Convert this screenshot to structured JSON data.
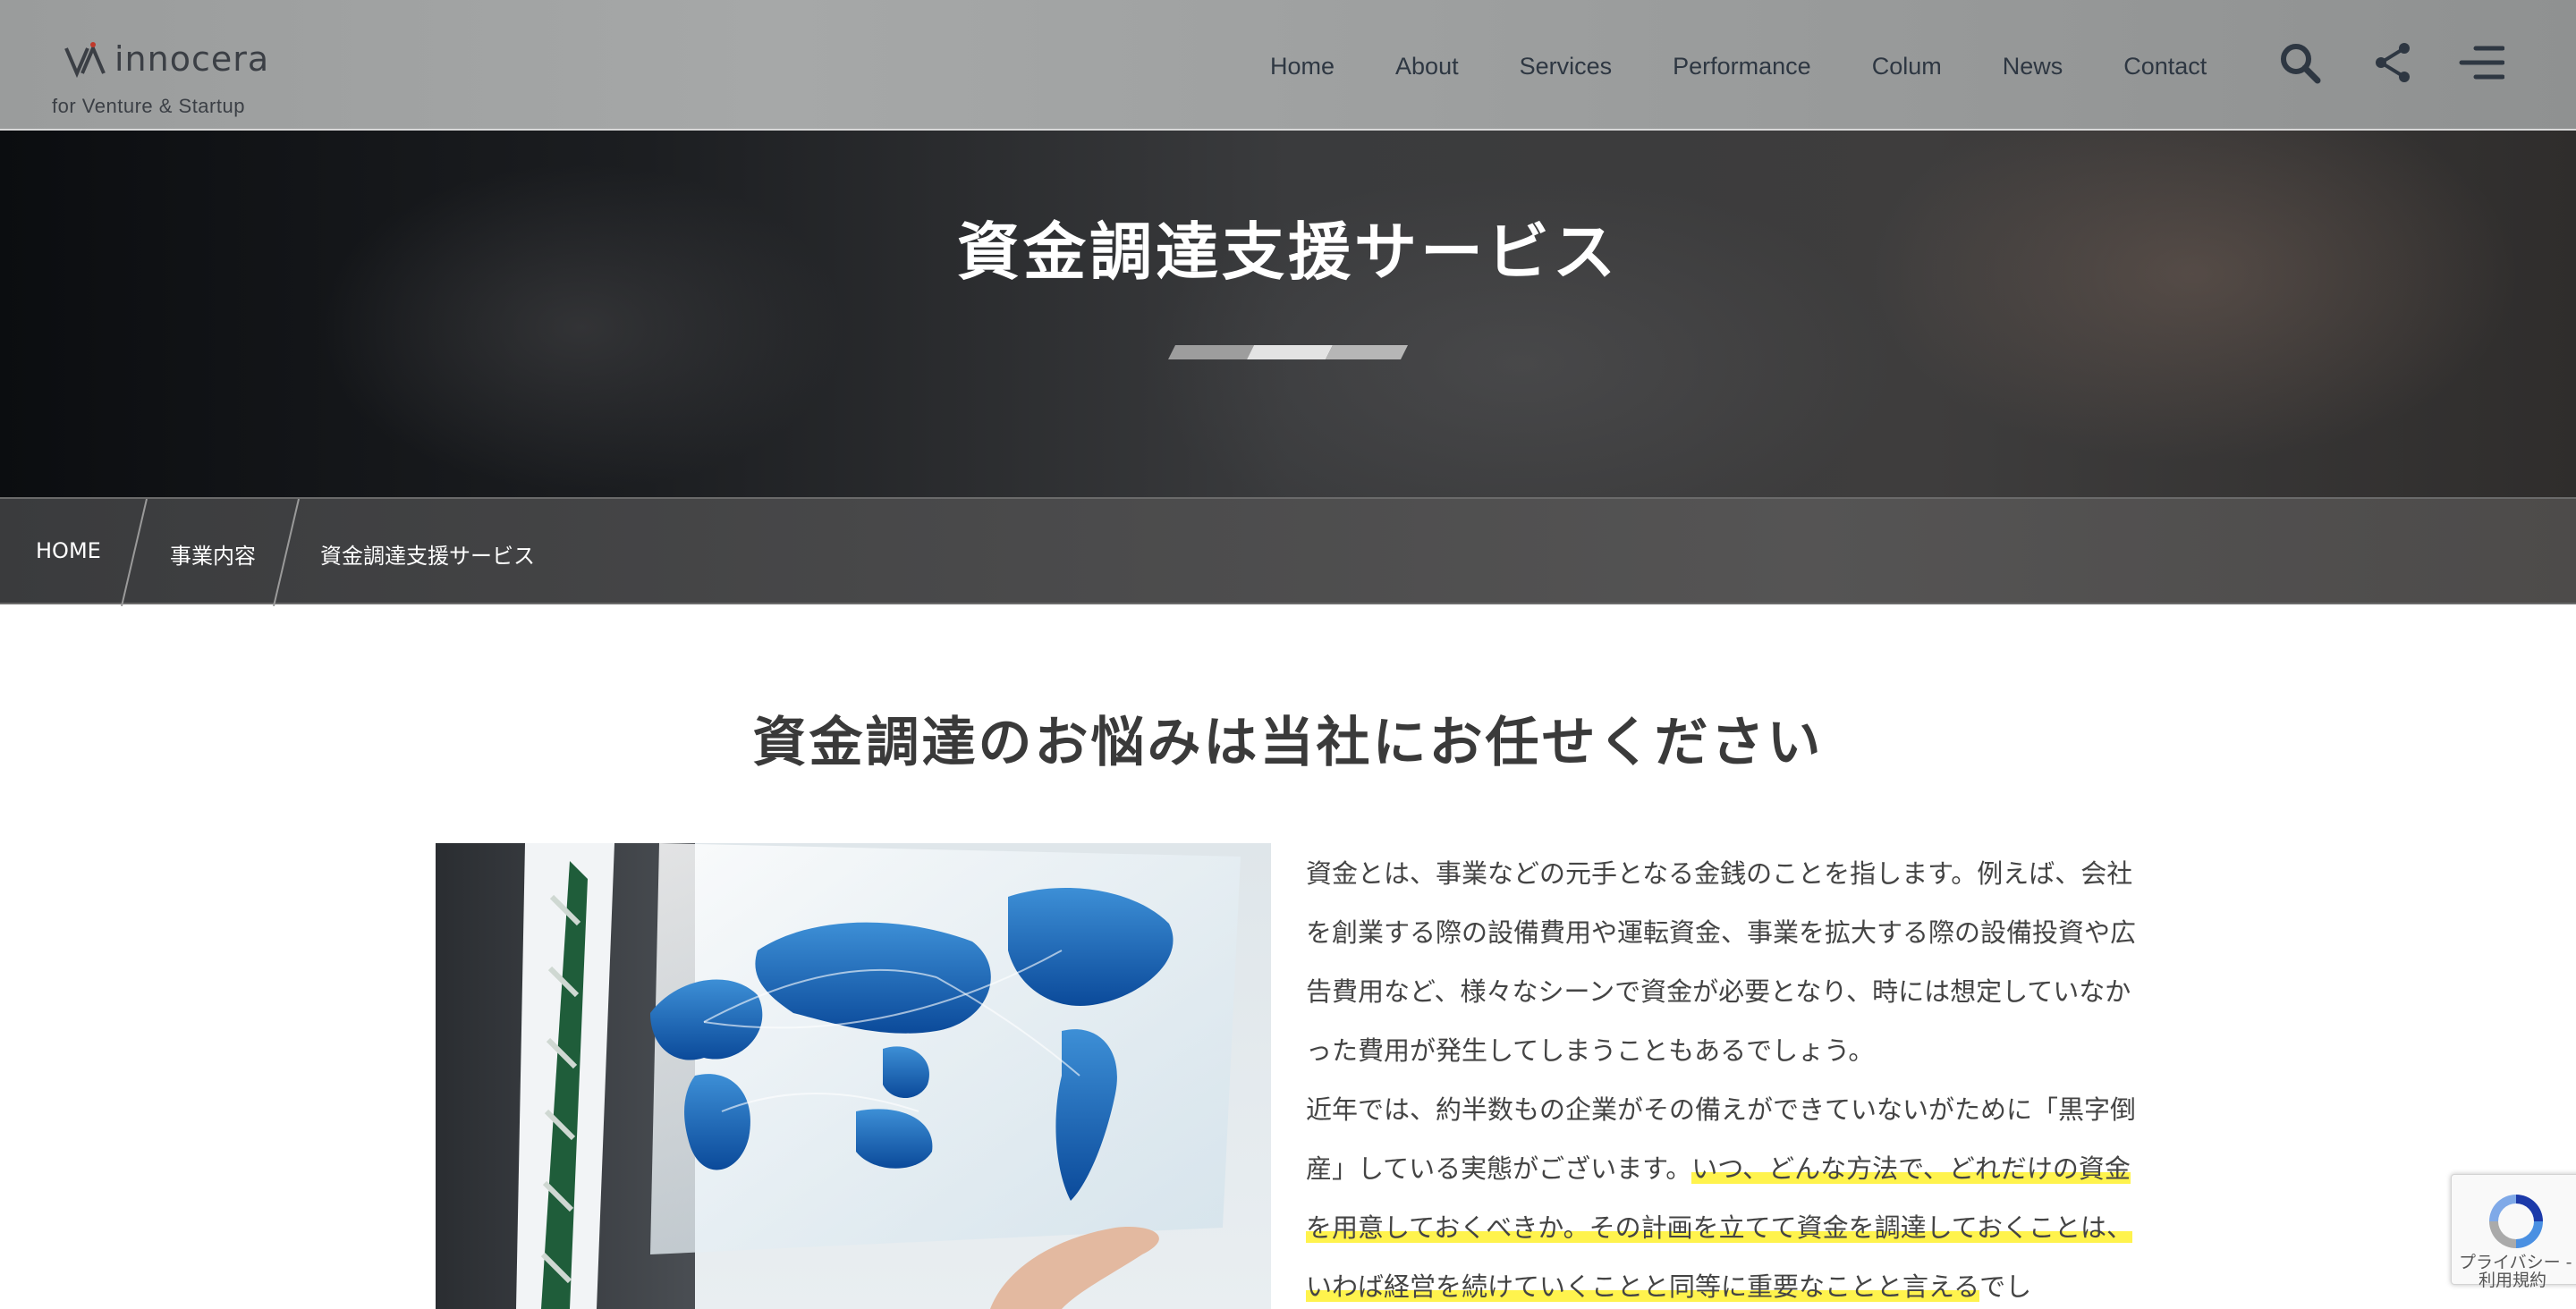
{
  "header": {
    "logo_word": "innocera",
    "logo_tagline": "for Venture & Startup",
    "nav": [
      {
        "label": "Home"
      },
      {
        "label": "About"
      },
      {
        "label": "Services"
      },
      {
        "label": "Performance"
      },
      {
        "label": "Colum"
      },
      {
        "label": "News"
      },
      {
        "label": "Contact"
      }
    ],
    "icons": [
      "search-icon",
      "share-icon",
      "menu-icon"
    ]
  },
  "hero": {
    "title": "資金調達支援サービス"
  },
  "breadcrumb": {
    "items": [
      {
        "label": "HOME"
      },
      {
        "label": "事業内容"
      },
      {
        "label": "資金調達支援サービス"
      }
    ]
  },
  "main": {
    "section_title": "資金調達のお悩みは当社にお任せください",
    "paragraph1": "資金とは、事業などの元手となる金銭のことを指します。例えば、会社を創業する際の設備費用や運転資金、事業を拡大する際の設備投資や広告費用など、様々なシーンで資金が必要となり、時には想定していなかった費用が発生してしまうこともあるでしょう。",
    "paragraph2_plain": "近年では、約半数もの企業がその備えができていないがために「黒字倒産」している実態がございます。",
    "paragraph2_highlight": "いつ、どんな方法で、どれだけの資金を用意しておくべきか。その計画を立てて資金を調達しておくことは、いわば経営を続けていくことと同等に重要なことと言える",
    "paragraph2_tail": "でし"
  },
  "recaptcha": {
    "line1": "プライバシー - ",
    "line2": "利用規約"
  },
  "colors": {
    "highlight": "#fff34d",
    "nav_text": "#2e3742",
    "hero_title": "#ffffff"
  }
}
